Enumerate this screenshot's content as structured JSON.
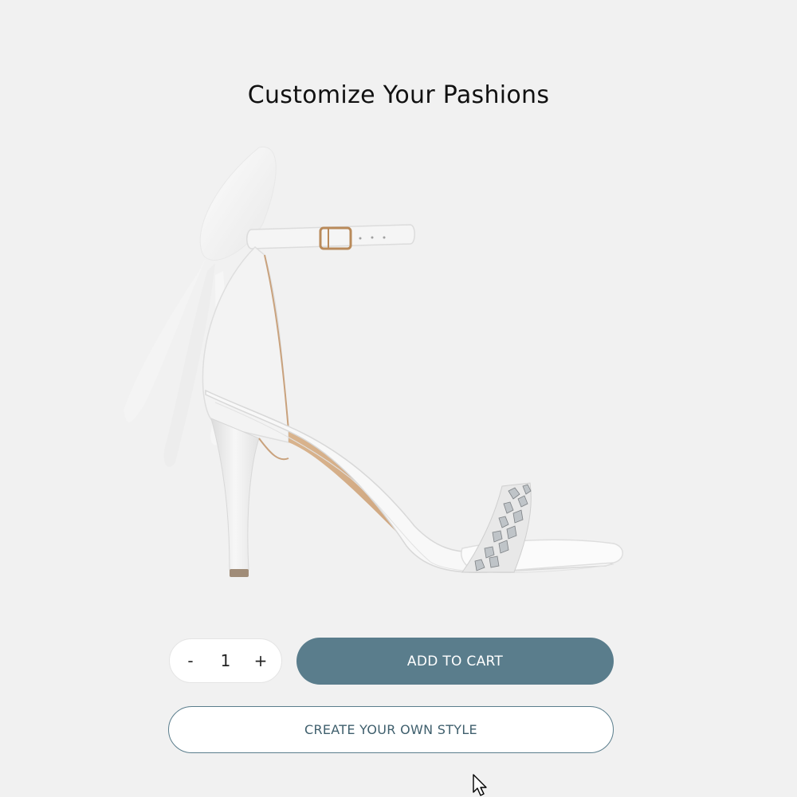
{
  "header": {
    "title": "Customize Your Pashions"
  },
  "product": {
    "image": "white-high-heel-sandal-with-bow-and-crystal-strap"
  },
  "quantity": {
    "decrement_label": "-",
    "value": "1",
    "increment_label": "+"
  },
  "actions": {
    "add_to_cart_label": "ADD TO CART",
    "create_style_label": "CREATE YOUR OWN STYLE"
  },
  "colors": {
    "background": "#f1f1f1",
    "accent": "#5a7d8c",
    "text": "#111111"
  }
}
